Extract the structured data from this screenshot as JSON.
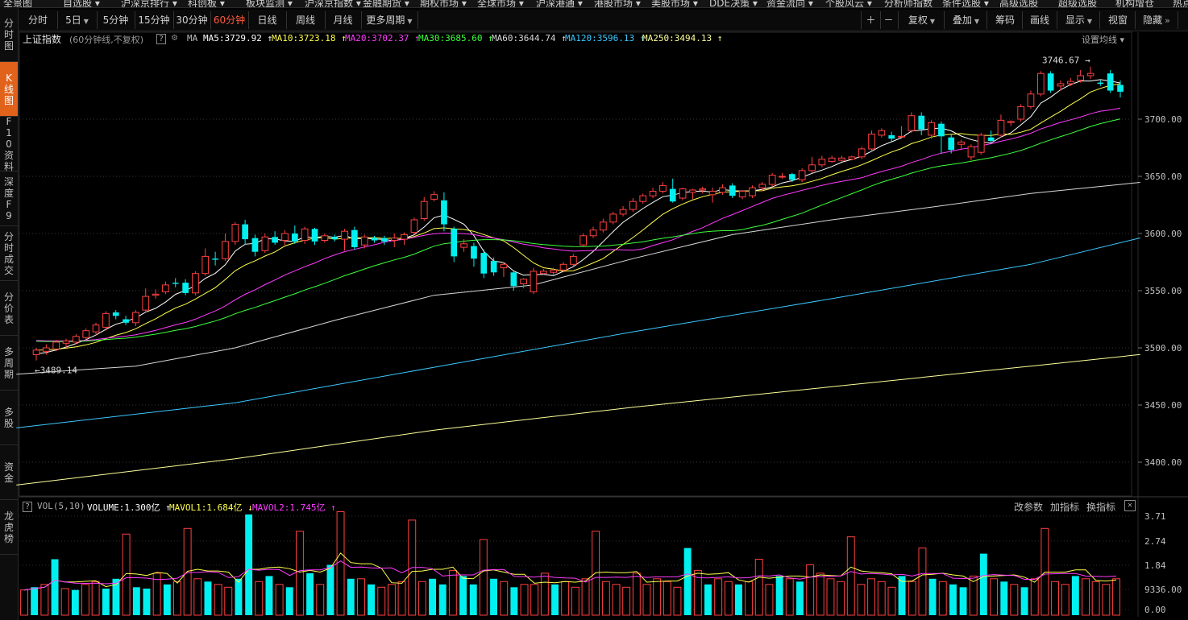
{
  "top_menu": [
    "全景图",
    "自选股 ▾",
    "沪深京排行 ▾",
    "科创板 ▾",
    "板块监测 ▾",
    "沪深京指数 ▾",
    "金融期货 ▾",
    "期权市场 ▾",
    "全球市场 ▾",
    "沪深港通 ▾",
    "港股市场 ▾",
    "美股市场 ▾",
    "DDE决策 ▾",
    "资金流向 ▾",
    "个股风云 ▾",
    "分析师指数",
    "条件选股 ▾",
    "高级选股",
    "超级选股",
    "机构增仓",
    "热点"
  ],
  "sidebar": [
    {
      "label": "分时图"
    },
    {
      "label": "K线图",
      "active": true
    },
    {
      "label": "F10资料"
    },
    {
      "label": "深度F9"
    },
    {
      "label": "分时成交"
    },
    {
      "label": "分价表"
    },
    {
      "label": "多周期"
    },
    {
      "label": "多股"
    },
    {
      "label": "资金"
    },
    {
      "label": "龙虎榜"
    }
  ],
  "toolbar": {
    "periods": [
      {
        "label": "分时"
      },
      {
        "label": "5日",
        "dropdown": true
      },
      {
        "label": "5分钟"
      },
      {
        "label": "15分钟"
      },
      {
        "label": "30分钟"
      },
      {
        "label": "60分钟",
        "active": true
      },
      {
        "label": "日线"
      },
      {
        "label": "周线"
      },
      {
        "label": "月线"
      },
      {
        "label": "更多周期",
        "dropdown": true
      }
    ],
    "right": [
      {
        "label": "＋"
      },
      {
        "label": "－"
      },
      {
        "label": "复权",
        "dropdown": true
      },
      {
        "label": "叠加",
        "dropdown": true
      },
      {
        "label": "筹码"
      },
      {
        "label": "画线"
      },
      {
        "label": "显示",
        "dropdown": true
      },
      {
        "label": "视窗"
      },
      {
        "label": "隐藏",
        "arrow": "»"
      }
    ]
  },
  "chart_header": {
    "title": "上证指数",
    "subtitle": "(60分钟线,不复权)",
    "ma_label": "MA",
    "ma": [
      {
        "text": "MA5:3729.92 ↑",
        "color": "#ffffff"
      },
      {
        "text": "MA10:3723.18 ↑",
        "color": "#ffff4d"
      },
      {
        "text": "MA20:3702.37 ↑",
        "color": "#ff3bff"
      },
      {
        "text": "MA30:3685.60 ↑",
        "color": "#3dff3d"
      },
      {
        "text": "MA60:3644.74 ↑",
        "color": "#d8d8d8"
      },
      {
        "text": "MA120:3596.13 ↑",
        "color": "#3cc8ff"
      },
      {
        "text": "MA250:3494.13 ↑",
        "color": "#ffff9a"
      }
    ],
    "settings": "设置均线 ▾"
  },
  "volume_header": {
    "name": "VOL(5,10)",
    "items": [
      {
        "text": "VOLUME:1.300亿 ↑",
        "color": "#ffffff"
      },
      {
        "text": "MAVOL1:1.684亿 ↓",
        "color": "#ffff4d"
      },
      {
        "text": "MAVOL2:1.745亿 ↑",
        "color": "#ff3bff"
      }
    ],
    "buttons": [
      "改参数",
      "加指标",
      "换指标"
    ],
    "close": "✕"
  },
  "annotations": {
    "high": "3746.67",
    "low": "3489.14"
  },
  "colors": {
    "up": "#ff4040",
    "down": "#00f0f0",
    "accent": "#e0621b"
  },
  "chart_data": [
    {
      "type": "candlestick",
      "title": "上证指数",
      "y_ticks": [
        3400,
        3450,
        3500,
        3550,
        3600,
        3650,
        3700
      ],
      "ylim": [
        3380,
        3770
      ],
      "candles": [
        {
          "o": 3494,
          "c": 3498,
          "h": 3500,
          "l": 3489
        },
        {
          "o": 3497,
          "c": 3500,
          "h": 3503,
          "l": 3494
        },
        {
          "o": 3499,
          "c": 3505,
          "h": 3507,
          "l": 3497
        },
        {
          "o": 3504,
          "c": 3506,
          "h": 3508,
          "l": 3500
        },
        {
          "o": 3505,
          "c": 3510,
          "h": 3512,
          "l": 3503
        },
        {
          "o": 3509,
          "c": 3515,
          "h": 3517,
          "l": 3507
        },
        {
          "o": 3514,
          "c": 3520,
          "h": 3522,
          "l": 3511
        },
        {
          "o": 3518,
          "c": 3530,
          "h": 3532,
          "l": 3515
        },
        {
          "o": 3531,
          "c": 3528,
          "h": 3533,
          "l": 3525
        },
        {
          "o": 3525,
          "c": 3522,
          "h": 3528,
          "l": 3520
        },
        {
          "o": 3522,
          "c": 3531,
          "h": 3533,
          "l": 3519
        },
        {
          "o": 3533,
          "c": 3545,
          "h": 3552,
          "l": 3531
        },
        {
          "o": 3546,
          "c": 3547,
          "h": 3551,
          "l": 3543
        },
        {
          "o": 3549,
          "c": 3555,
          "h": 3558,
          "l": 3547
        },
        {
          "o": 3557,
          "c": 3556,
          "h": 3561,
          "l": 3553
        },
        {
          "o": 3557,
          "c": 3548,
          "h": 3560,
          "l": 3546
        },
        {
          "o": 3548,
          "c": 3565,
          "h": 3567,
          "l": 3546
        },
        {
          "o": 3565,
          "c": 3580,
          "h": 3587,
          "l": 3563
        },
        {
          "o": 3578,
          "c": 3577,
          "h": 3584,
          "l": 3572
        },
        {
          "o": 3578,
          "c": 3593,
          "h": 3600,
          "l": 3576
        },
        {
          "o": 3593,
          "c": 3608,
          "h": 3610,
          "l": 3590
        },
        {
          "o": 3608,
          "c": 3595,
          "h": 3612,
          "l": 3590
        },
        {
          "o": 3596,
          "c": 3584,
          "h": 3599,
          "l": 3580
        },
        {
          "o": 3585,
          "c": 3597,
          "h": 3600,
          "l": 3583
        },
        {
          "o": 3597,
          "c": 3592,
          "h": 3602,
          "l": 3590
        },
        {
          "o": 3594,
          "c": 3600,
          "h": 3603,
          "l": 3590
        },
        {
          "o": 3600,
          "c": 3593,
          "h": 3607,
          "l": 3591
        },
        {
          "o": 3594,
          "c": 3604,
          "h": 3606,
          "l": 3591
        },
        {
          "o": 3604,
          "c": 3593,
          "h": 3605,
          "l": 3590
        },
        {
          "o": 3594,
          "c": 3598,
          "h": 3600,
          "l": 3592
        },
        {
          "o": 3597,
          "c": 3595,
          "h": 3599,
          "l": 3593
        },
        {
          "o": 3595,
          "c": 3602,
          "h": 3604,
          "l": 3585
        },
        {
          "o": 3603,
          "c": 3588,
          "h": 3606,
          "l": 3586
        },
        {
          "o": 3590,
          "c": 3597,
          "h": 3599,
          "l": 3587
        },
        {
          "o": 3596,
          "c": 3594,
          "h": 3598,
          "l": 3592
        },
        {
          "o": 3596,
          "c": 3593,
          "h": 3598,
          "l": 3590
        },
        {
          "o": 3594,
          "c": 3596,
          "h": 3600,
          "l": 3588
        },
        {
          "o": 3595,
          "c": 3599,
          "h": 3601,
          "l": 3590
        },
        {
          "o": 3601,
          "c": 3612,
          "h": 3614,
          "l": 3599
        },
        {
          "o": 3613,
          "c": 3628,
          "h": 3632,
          "l": 3611
        },
        {
          "o": 3630,
          "c": 3634,
          "h": 3637,
          "l": 3628
        },
        {
          "o": 3629,
          "c": 3608,
          "h": 3636,
          "l": 3602
        },
        {
          "o": 3604,
          "c": 3580,
          "h": 3606,
          "l": 3575
        },
        {
          "o": 3588,
          "c": 3591,
          "h": 3595,
          "l": 3584
        },
        {
          "o": 3589,
          "c": 3578,
          "h": 3592,
          "l": 3571
        },
        {
          "o": 3583,
          "c": 3565,
          "h": 3586,
          "l": 3561
        },
        {
          "o": 3576,
          "c": 3566,
          "h": 3579,
          "l": 3563
        },
        {
          "o": 3570,
          "c": 3573,
          "h": 3575,
          "l": 3562
        },
        {
          "o": 3566,
          "c": 3554,
          "h": 3568,
          "l": 3550
        },
        {
          "o": 3556,
          "c": 3560,
          "h": 3561,
          "l": 3552
        },
        {
          "o": 3549,
          "c": 3567,
          "h": 3570,
          "l": 3547
        },
        {
          "o": 3565,
          "c": 3567,
          "h": 3569,
          "l": 3564
        },
        {
          "o": 3566,
          "c": 3568,
          "h": 3570,
          "l": 3564
        },
        {
          "o": 3568,
          "c": 3573,
          "h": 3575,
          "l": 3566
        },
        {
          "o": 3573,
          "c": 3580,
          "h": 3582,
          "l": 3571
        },
        {
          "o": 3590,
          "c": 3598,
          "h": 3600,
          "l": 3588
        },
        {
          "o": 3598,
          "c": 3603,
          "h": 3606,
          "l": 3596
        },
        {
          "o": 3603,
          "c": 3610,
          "h": 3613,
          "l": 3601
        },
        {
          "o": 3610,
          "c": 3617,
          "h": 3619,
          "l": 3608
        },
        {
          "o": 3617,
          "c": 3621,
          "h": 3624,
          "l": 3615
        },
        {
          "o": 3621,
          "c": 3628,
          "h": 3631,
          "l": 3619
        },
        {
          "o": 3628,
          "c": 3633,
          "h": 3635,
          "l": 3626
        },
        {
          "o": 3633,
          "c": 3637,
          "h": 3640,
          "l": 3631
        },
        {
          "o": 3637,
          "c": 3642,
          "h": 3645,
          "l": 3635
        },
        {
          "o": 3639,
          "c": 3628,
          "h": 3648,
          "l": 3627
        },
        {
          "o": 3631,
          "c": 3639,
          "h": 3640,
          "l": 3629
        },
        {
          "o": 3636,
          "c": 3638,
          "h": 3639,
          "l": 3630
        },
        {
          "o": 3638,
          "c": 3639,
          "h": 3641,
          "l": 3635
        },
        {
          "o": 3634,
          "c": 3637,
          "h": 3640,
          "l": 3627
        },
        {
          "o": 3636,
          "c": 3640,
          "h": 3643,
          "l": 3634
        },
        {
          "o": 3642,
          "c": 3633,
          "h": 3644,
          "l": 3631
        },
        {
          "o": 3632,
          "c": 3637,
          "h": 3638,
          "l": 3630
        },
        {
          "o": 3633,
          "c": 3640,
          "h": 3642,
          "l": 3631
        },
        {
          "o": 3640,
          "c": 3643,
          "h": 3645,
          "l": 3637
        },
        {
          "o": 3643,
          "c": 3651,
          "h": 3653,
          "l": 3641
        },
        {
          "o": 3650,
          "c": 3650,
          "h": 3653,
          "l": 3648
        },
        {
          "o": 3652,
          "c": 3647,
          "h": 3653,
          "l": 3645
        },
        {
          "o": 3647,
          "c": 3655,
          "h": 3657,
          "l": 3645
        },
        {
          "o": 3655,
          "c": 3660,
          "h": 3667,
          "l": 3653
        },
        {
          "o": 3660,
          "c": 3665,
          "h": 3668,
          "l": 3658
        },
        {
          "o": 3663,
          "c": 3666,
          "h": 3668,
          "l": 3662
        },
        {
          "o": 3664,
          "c": 3666,
          "h": 3668,
          "l": 3663
        },
        {
          "o": 3665,
          "c": 3667,
          "h": 3668,
          "l": 3664
        },
        {
          "o": 3667,
          "c": 3674,
          "h": 3676,
          "l": 3665
        },
        {
          "o": 3674,
          "c": 3687,
          "h": 3690,
          "l": 3672
        },
        {
          "o": 3686,
          "c": 3690,
          "h": 3692,
          "l": 3684
        },
        {
          "o": 3686,
          "c": 3683,
          "h": 3689,
          "l": 3680
        },
        {
          "o": 3685,
          "c": 3685,
          "h": 3694,
          "l": 3684
        },
        {
          "o": 3690,
          "c": 3703,
          "h": 3706,
          "l": 3688
        },
        {
          "o": 3703,
          "c": 3691,
          "h": 3706,
          "l": 3686
        },
        {
          "o": 3686,
          "c": 3697,
          "h": 3699,
          "l": 3683
        },
        {
          "o": 3696,
          "c": 3685,
          "h": 3698,
          "l": 3670
        },
        {
          "o": 3684,
          "c": 3673,
          "h": 3687,
          "l": 3670
        },
        {
          "o": 3678,
          "c": 3680,
          "h": 3682,
          "l": 3673
        },
        {
          "o": 3667,
          "c": 3676,
          "h": 3678,
          "l": 3664
        },
        {
          "o": 3671,
          "c": 3686,
          "h": 3688,
          "l": 3669
        },
        {
          "o": 3684,
          "c": 3681,
          "h": 3690,
          "l": 3680
        },
        {
          "o": 3686,
          "c": 3699,
          "h": 3704,
          "l": 3684
        },
        {
          "o": 3697,
          "c": 3698,
          "h": 3699,
          "l": 3694
        },
        {
          "o": 3700,
          "c": 3711,
          "h": 3713,
          "l": 3698
        },
        {
          "o": 3711,
          "c": 3722,
          "h": 3725,
          "l": 3709
        },
        {
          "o": 3722,
          "c": 3740,
          "h": 3742,
          "l": 3720
        },
        {
          "o": 3740,
          "c": 3725,
          "h": 3742,
          "l": 3723
        },
        {
          "o": 3729,
          "c": 3731,
          "h": 3734,
          "l": 3725
        },
        {
          "o": 3731,
          "c": 3733,
          "h": 3736,
          "l": 3729
        },
        {
          "o": 3734,
          "c": 3738,
          "h": 3743,
          "l": 3732
        },
        {
          "o": 3738,
          "c": 3740,
          "h": 3746,
          "l": 3735
        },
        {
          "o": 3732,
          "c": 3731,
          "h": 3734,
          "l": 3729
        },
        {
          "o": 3740,
          "c": 3725,
          "h": 3743,
          "l": 3723
        },
        {
          "o": 3730,
          "c": 3724,
          "h": 3734,
          "l": 3719
        }
      ],
      "volume": {
        "y_ticks": [
          "3.71",
          "2.74",
          "1.84",
          "9336.00",
          "0.00"
        ],
        "vmax": 3.8,
        "bars": [
          0.9,
          1.0,
          1.1,
          2.0,
          0.95,
          0.9,
          1.1,
          1.2,
          0.95,
          1.3,
          2.9,
          1.0,
          0.95,
          1.5,
          1.1,
          1.2,
          3.1,
          1.3,
          1.2,
          1.1,
          1.0,
          1.3,
          3.6,
          1.2,
          1.4,
          1.1,
          1.0,
          3.0,
          1.5,
          1.1,
          1.8,
          3.7,
          1.3,
          1.3,
          1.1,
          1.0,
          1.1,
          1.2,
          3.4,
          1.2,
          1.3,
          1.1,
          1.6,
          1.4,
          1.1,
          2.7,
          1.3,
          1.2,
          1.0,
          1.1,
          1.1,
          1.5,
          1.1,
          1.2,
          1.0,
          1.3,
          3.0,
          1.2,
          1.1,
          1.0,
          1.5,
          1.1,
          1.3,
          1.2,
          1.0,
          2.4,
          1.6,
          1.1,
          1.3,
          1.2,
          1.1,
          1.2,
          2.0,
          1.1,
          1.4,
          1.3,
          1.2,
          1.8,
          1.5,
          1.3,
          1.2,
          2.8,
          1.1,
          1.3,
          1.2,
          1.0,
          1.4,
          1.2,
          2.4,
          1.3,
          1.2,
          1.1,
          1.0,
          1.4,
          2.2,
          1.3,
          1.2,
          1.1,
          1.0,
          1.3,
          3.1,
          1.2,
          1.1,
          1.4,
          1.3,
          1.2,
          1.1,
          1.3
        ],
        "up": [
          1,
          0,
          1,
          0,
          1,
          0,
          1,
          1,
          0,
          0,
          1,
          0,
          0,
          1,
          0,
          1,
          1,
          1,
          0,
          1,
          1,
          0,
          0,
          1,
          0,
          1,
          0,
          1,
          0,
          1,
          0,
          1,
          0,
          1,
          0,
          1,
          1,
          1,
          1,
          1,
          0,
          0,
          1,
          0,
          0,
          1,
          0,
          1,
          0,
          1,
          1,
          1,
          0,
          1,
          1,
          1,
          1,
          1,
          1,
          1,
          1,
          1,
          1,
          1,
          1,
          0,
          1,
          0,
          1,
          1,
          0,
          1,
          1,
          1,
          0,
          1,
          0,
          1,
          1,
          1,
          1,
          1,
          1,
          1,
          1,
          1,
          0,
          1,
          1,
          0,
          1,
          0,
          0,
          1,
          0,
          1,
          0,
          1,
          0,
          1,
          1,
          1,
          1,
          0,
          1,
          1,
          1,
          1
        ]
      }
    }
  ]
}
